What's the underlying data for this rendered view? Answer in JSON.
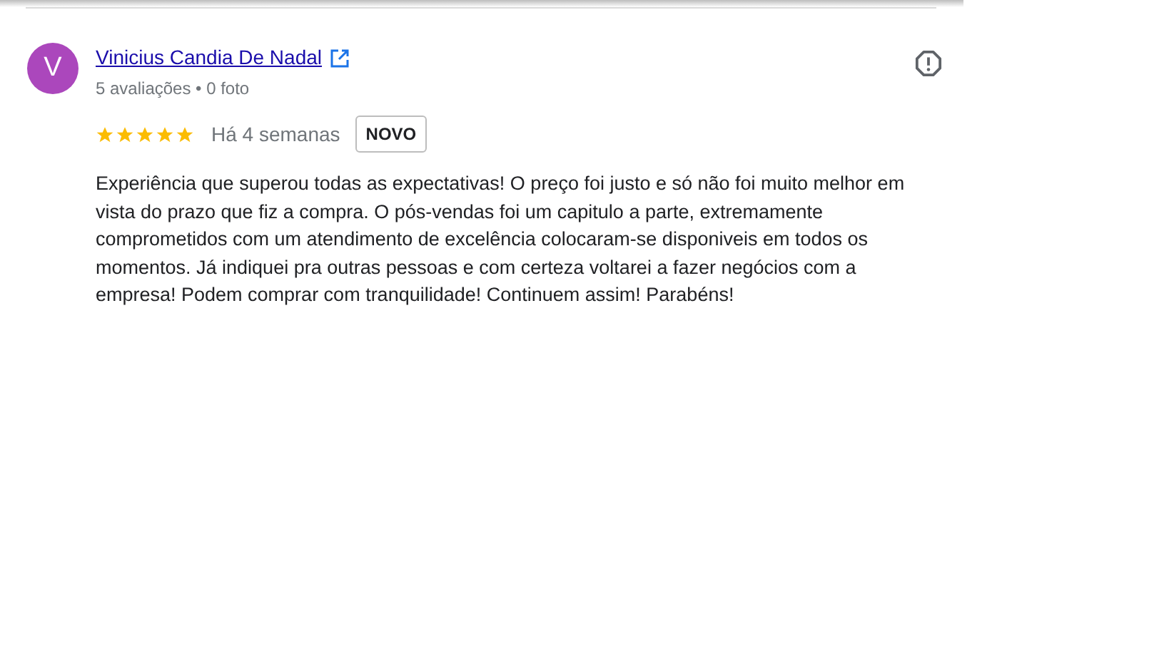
{
  "review": {
    "avatar_letter": "V",
    "author": "Vinicius Candia De Nadal",
    "author_meta": "5 avaliações • 0 foto",
    "stars": 5,
    "time": "Há 4 semanas",
    "badge": "NOVO",
    "text": "Experiência que superou todas as expectativas! O preço foi justo e só não foi muito melhor em vista do prazo que fiz a compra. O pós-vendas foi um capitulo a parte, extremamente comprometidos com um atendimento de excelência colocaram-se disponiveis em todos os momentos. Já indiquei pra outras pessoas e com certeza voltarei a fazer negócios com a empresa! Podem comprar com tranquilidade! Continuem assim! Parabéns!"
  }
}
